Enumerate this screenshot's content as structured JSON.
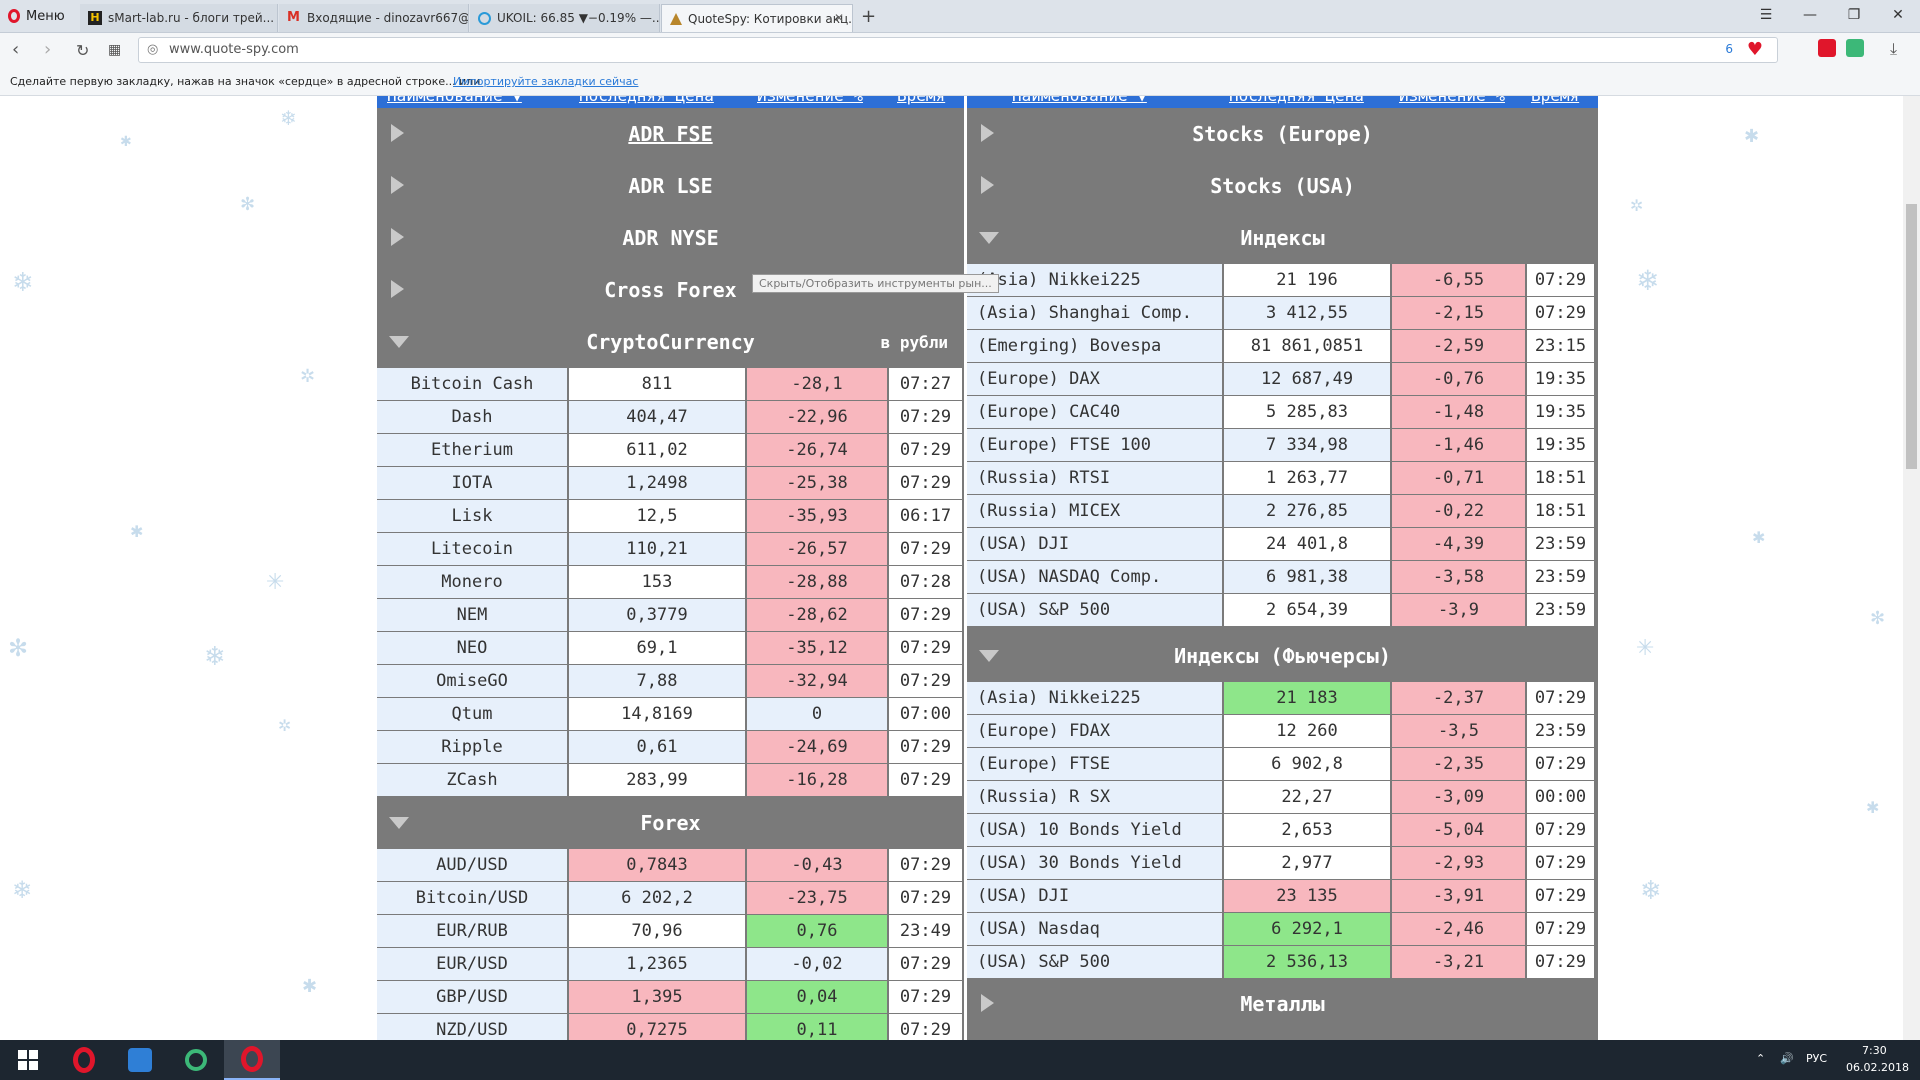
{
  "browser": {
    "menu_label": "Меню",
    "tabs": [
      {
        "title": "sMart-lab.ru - блоги трей..."
      },
      {
        "title": "Входящие - dinozavr667@..."
      },
      {
        "title": "UKOIL: 66.85 ▼−0.19% —..."
      },
      {
        "title": "QuoteSpy: Котировки акц..."
      }
    ],
    "url": "www.quote-spy.com",
    "vpn_badge": "6",
    "bookmarks_hint": "Сделайте первую закладку, нажав на значок «сердце» в адресной строке... или",
    "bookmarks_link": "Импортируйте закладки сейчас"
  },
  "columns": {
    "name": "Наименование ▼",
    "price": "Последняя Цена",
    "change": "Изменение %",
    "time": "Время"
  },
  "tooltip": "Скрыть/Отобразить инструменты рын...",
  "left_panel": {
    "collapsed_groups": [
      "ADR FSE",
      "ADR LSE",
      "ADR NYSE",
      "Cross Forex"
    ],
    "crypto": {
      "title": "CryptoCurrency",
      "unit": "в рубли",
      "rows": [
        {
          "name": "Bitcoin Cash",
          "price": "811",
          "change": "-28,1",
          "time": "07:27"
        },
        {
          "name": "Dash",
          "price": "404,47",
          "change": "-22,96",
          "time": "07:29"
        },
        {
          "name": "Etherium",
          "price": "611,02",
          "change": "-26,74",
          "time": "07:29"
        },
        {
          "name": "IOTA",
          "price": "1,2498",
          "change": "-25,38",
          "time": "07:29"
        },
        {
          "name": "Lisk",
          "price": "12,5",
          "change": "-35,93",
          "time": "06:17"
        },
        {
          "name": "Litecoin",
          "price": "110,21",
          "change": "-26,57",
          "time": "07:29"
        },
        {
          "name": "Monero",
          "price": "153",
          "change": "-28,88",
          "time": "07:28"
        },
        {
          "name": "NEM",
          "price": "0,3779",
          "change": "-28,62",
          "time": "07:29"
        },
        {
          "name": "NEO",
          "price": "69,1",
          "change": "-35,12",
          "time": "07:29"
        },
        {
          "name": "OmiseGO",
          "price": "7,88",
          "change": "-32,94",
          "time": "07:29"
        },
        {
          "name": "Qtum",
          "price": "14,8169",
          "change": "0",
          "time": "07:00"
        },
        {
          "name": "Ripple",
          "price": "0,61",
          "change": "-24,69",
          "time": "07:29"
        },
        {
          "name": "ZCash",
          "price": "283,99",
          "change": "-16,28",
          "time": "07:29"
        }
      ]
    },
    "forex": {
      "title": "Forex",
      "rows": [
        {
          "name": "AUD/USD",
          "price": "0,7843",
          "change": "-0,43",
          "time": "07:29"
        },
        {
          "name": "Bitcoin/USD",
          "price": "6 202,2",
          "change": "-23,75",
          "time": "07:29"
        },
        {
          "name": "EUR/RUB",
          "price": "70,96",
          "change": "0,76",
          "time": "23:49"
        },
        {
          "name": "EUR/USD",
          "price": "1,2365",
          "change": "-0,02",
          "time": "07:29"
        },
        {
          "name": "GBP/USD",
          "price": "1,395",
          "change": "0,04",
          "time": "07:29"
        },
        {
          "name": "NZD/USD",
          "price": "0,7275",
          "change": "0,11",
          "time": "07:29"
        }
      ]
    }
  },
  "right_panel": {
    "collapsed_groups": [
      "Stocks (Europe)",
      "Stocks (USA)"
    ],
    "indices": {
      "title": "Индексы",
      "rows": [
        {
          "name": "(Asia) Nikkei225",
          "price": "21 196",
          "change": "-6,55",
          "time": "07:29"
        },
        {
          "name": "(Asia) Shanghai Comp.",
          "price": "3 412,55",
          "change": "-2,15",
          "time": "07:29"
        },
        {
          "name": "(Emerging) Bovespa",
          "price": "81 861,0851",
          "change": "-2,59",
          "time": "23:15"
        },
        {
          "name": "(Europe) DAX",
          "price": "12 687,49",
          "change": "-0,76",
          "time": "19:35"
        },
        {
          "name": "(Europe) CAC40",
          "price": "5 285,83",
          "change": "-1,48",
          "time": "19:35"
        },
        {
          "name": "(Europe) FTSE 100",
          "price": "7 334,98",
          "change": "-1,46",
          "time": "19:35"
        },
        {
          "name": "(Russia) RTSI",
          "price": "1 263,77",
          "change": "-0,71",
          "time": "18:51"
        },
        {
          "name": "(Russia) MICEX",
          "price": "2 276,85",
          "change": "-0,22",
          "time": "18:51"
        },
        {
          "name": "(USA) DJI",
          "price": "24 401,8",
          "change": "-4,39",
          "time": "23:59"
        },
        {
          "name": "(USA) NASDAQ Comp.",
          "price": "6 981,38",
          "change": "-3,58",
          "time": "23:59"
        },
        {
          "name": "(USA) S&P 500",
          "price": "2 654,39",
          "change": "-3,9",
          "time": "23:59"
        }
      ]
    },
    "futures": {
      "title": "Индексы (Фьючерсы)",
      "rows": [
        {
          "name": "(Asia) Nikkei225",
          "price": "21 183",
          "change": "-2,37",
          "time": "07:29"
        },
        {
          "name": "(Europe) FDAX",
          "price": "12 260",
          "change": "-3,5",
          "time": "23:59"
        },
        {
          "name": "(Europe) FTSE",
          "price": "6 902,8",
          "change": "-2,35",
          "time": "07:29"
        },
        {
          "name": "(Russia) R SX",
          "price": "22,27",
          "change": "-3,09",
          "time": "00:00"
        },
        {
          "name": "(USA) 10 Bonds Yield",
          "price": "2,653",
          "change": "-5,04",
          "time": "07:29"
        },
        {
          "name": "(USA) 30 Bonds Yield",
          "price": "2,977",
          "change": "-2,93",
          "time": "07:29"
        },
        {
          "name": "(USA) DJI",
          "price": "23 135",
          "change": "-3,91",
          "time": "07:29"
        },
        {
          "name": "(USA) Nasdaq",
          "price": "6 292,1",
          "change": "-2,46",
          "time": "07:29"
        },
        {
          "name": "(USA) S&P 500",
          "price": "2 536,13",
          "change": "-3,21",
          "time": "07:29"
        }
      ]
    },
    "metals": {
      "title": "Металлы"
    }
  },
  "taskbar": {
    "lang": "РУС",
    "time": "7:30",
    "date": "06.02.2018"
  },
  "colors": {
    "negative": "#f8b7be",
    "positive": "#8ee68a",
    "panel": "#7a7a7a",
    "header": "#2d6fd6"
  }
}
